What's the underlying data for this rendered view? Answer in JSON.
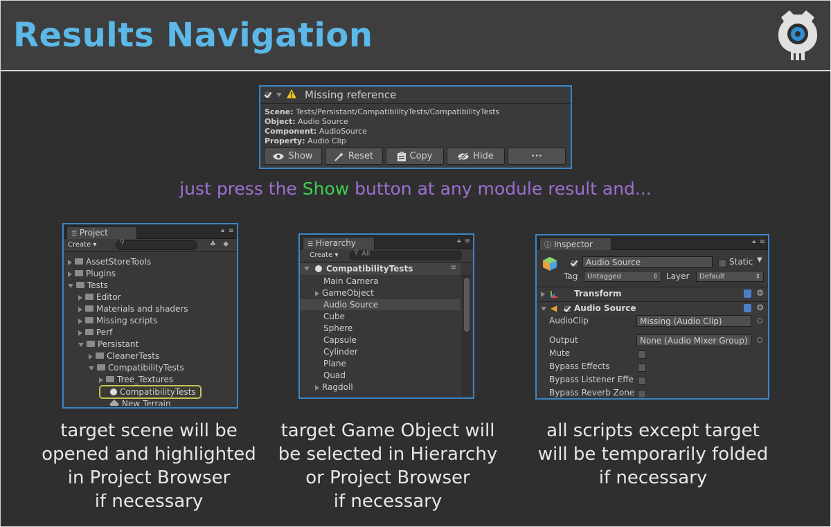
{
  "title": "Results Navigation",
  "result_card": {
    "header": "Missing reference",
    "rows": [
      {
        "key": "Scene:",
        "value": "Tests/Persistant/CompatibilityTests/CompatibilityTests"
      },
      {
        "key": "Object:",
        "value": "Audio Source"
      },
      {
        "key": "Component:",
        "value": "AudioSource"
      },
      {
        "key": "Property:",
        "value": "Audio Clip"
      }
    ],
    "buttons": {
      "show": "Show",
      "reset": "Reset",
      "copy": "Copy",
      "hide": "Hide",
      "more": "•••"
    }
  },
  "tagline": {
    "pre": "just press the ",
    "highlight": "Show",
    "post": " button at any module result and...",
    "highlight_color": "#3fcf4f",
    "text_color": "#9e6fd0"
  },
  "project": {
    "tab": "Project",
    "create": "Create ▾",
    "items": [
      {
        "label": "AssetStoreTools",
        "indent": 0,
        "open": false
      },
      {
        "label": "Plugins",
        "indent": 0,
        "open": false
      },
      {
        "label": "Tests",
        "indent": 0,
        "open": true
      },
      {
        "label": "Editor",
        "indent": 1,
        "open": false
      },
      {
        "label": "Materials and shaders",
        "indent": 1,
        "open": false
      },
      {
        "label": "Missing scripts",
        "indent": 1,
        "open": false
      },
      {
        "label": "Perf",
        "indent": 1,
        "open": false
      },
      {
        "label": "Persistant",
        "indent": 1,
        "open": true
      },
      {
        "label": "CleanerTests",
        "indent": 2,
        "open": false
      },
      {
        "label": "CompatibilityTests",
        "indent": 2,
        "open": true
      },
      {
        "label": "Tree_Textures",
        "indent": 3,
        "open": false
      },
      {
        "label": "CompatibilityTests",
        "indent": 3,
        "highlight": true
      },
      {
        "label": "New Terrain",
        "indent": 3
      }
    ]
  },
  "hierarchy": {
    "tab": "Hierarchy",
    "create": "Create ▾",
    "search_placeholder": "All",
    "scene": "CompatibilityTests",
    "items": [
      "Main Camera",
      "GameObject",
      "Audio Source",
      "Cube",
      "Sphere",
      "Capsule",
      "Cylinder",
      "Plane",
      "Quad",
      "Ragdoll"
    ]
  },
  "inspector": {
    "tab": "Inspector",
    "name": "Audio Source",
    "static": "Static",
    "tag_label": "Tag",
    "tag_value": "Untagged",
    "layer_label": "Layer",
    "layer_value": "Default",
    "transform": "Transform",
    "audio_source": "Audio Source",
    "fields": [
      {
        "label": "AudioClip",
        "value": "Missing (Audio Clip)"
      },
      {
        "label": "Output",
        "value": "None (Audio Mixer Group)"
      },
      {
        "label": "Mute"
      },
      {
        "label": "Bypass Effects"
      },
      {
        "label": "Bypass Listener Effe"
      },
      {
        "label": "Bypass Reverb Zone"
      }
    ]
  },
  "captions": {
    "left": [
      "target scene will be",
      "opened and highlighted",
      "in Project Browser",
      "if necessary"
    ],
    "center": [
      "target Game Object will",
      "be selected in Hierarchy",
      "or Project Browser",
      "if necessary"
    ],
    "right": [
      "all scripts except target",
      "will be temporarily folded",
      "if necessary"
    ]
  },
  "colors": {
    "title": "#5bb8e8",
    "panel_border": "#3a86c8",
    "logo_accent": "#2f8fd0"
  }
}
